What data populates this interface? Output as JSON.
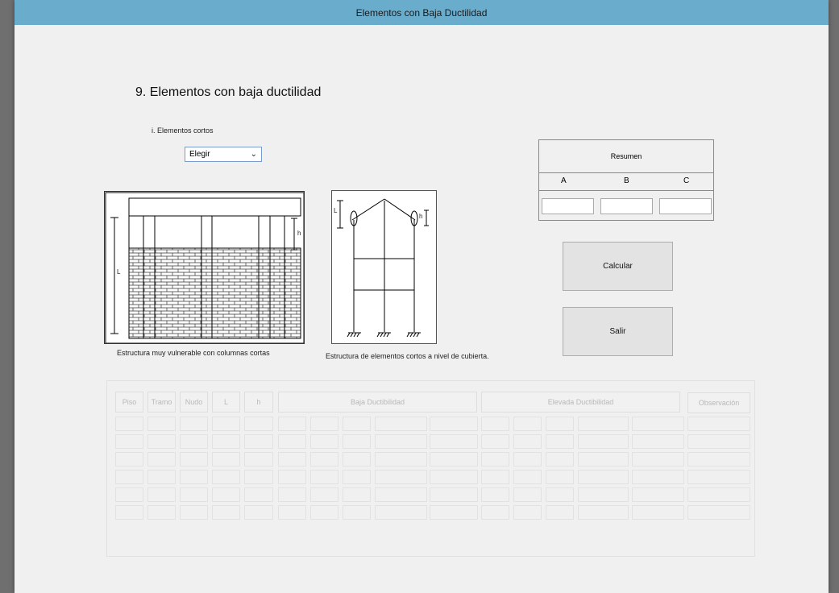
{
  "window": {
    "title": "Elementos con Baja Ductilidad"
  },
  "section": {
    "title": "9. Elementos con baja ductilidad",
    "subtitle": "i. Elementos cortos"
  },
  "dropdown": {
    "selected": "Elegir"
  },
  "figures": [
    {
      "caption": "Estructura muy vulnerable con columnas  cortas",
      "labels": [
        "L",
        "h"
      ]
    },
    {
      "caption": "Estructura de elementos cortos a nivel de cubierta.",
      "labels": [
        "L",
        "h"
      ]
    }
  ],
  "resumen": {
    "title": "Resumen",
    "columns": [
      "A",
      "B",
      "C"
    ],
    "values": [
      "",
      "",
      ""
    ]
  },
  "buttons": {
    "calcular": "Calcular",
    "salir": "Salir"
  },
  "table": {
    "headers": [
      "Piso",
      "Tramo",
      "Nudo",
      "L",
      "h",
      "Baja Ductibilidad",
      "Elevada Ductibilidad",
      "Observación"
    ],
    "row_count": 6
  },
  "colors": {
    "title_bar": "#6aaccc",
    "window_bg": "#f0f0f0"
  },
  "icons": {
    "dropdown": "chevron-down-icon"
  }
}
